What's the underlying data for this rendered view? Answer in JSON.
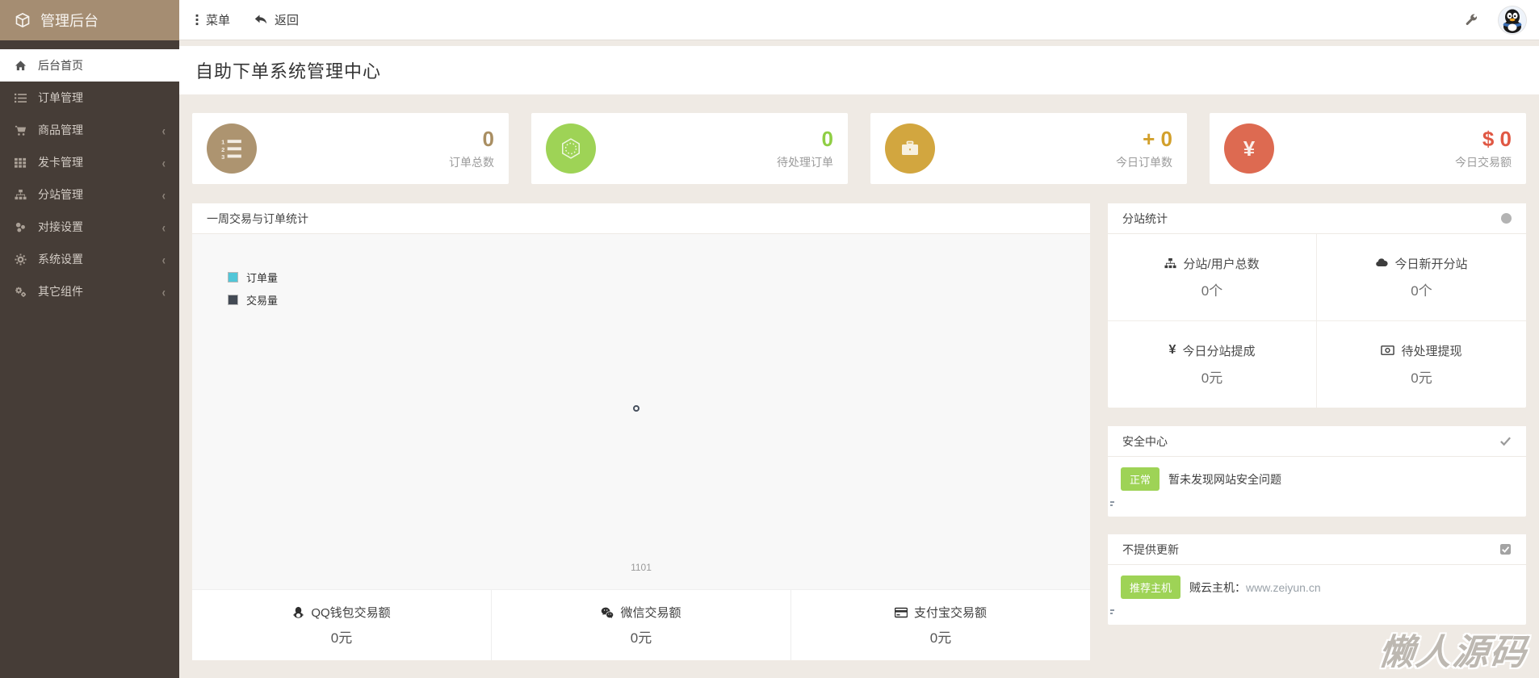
{
  "brand": {
    "title": "管理后台"
  },
  "topbar": {
    "menu": "菜单",
    "back": "返回"
  },
  "page": {
    "title": "自助下单系统管理中心"
  },
  "sidebar": {
    "items": [
      {
        "label": "后台首页",
        "icon": "home-icon",
        "active": true,
        "expandable": false
      },
      {
        "label": "订单管理",
        "icon": "list-icon",
        "active": false,
        "expandable": false
      },
      {
        "label": "商品管理",
        "icon": "cart-icon",
        "active": false,
        "expandable": true
      },
      {
        "label": "发卡管理",
        "icon": "grid-icon",
        "active": false,
        "expandable": true
      },
      {
        "label": "分站管理",
        "icon": "sitemap-icon",
        "active": false,
        "expandable": true
      },
      {
        "label": "对接设置",
        "icon": "links-icon",
        "active": false,
        "expandable": true
      },
      {
        "label": "系统设置",
        "icon": "gear-icon",
        "active": false,
        "expandable": true
      },
      {
        "label": "其它组件",
        "icon": "cogs-icon",
        "active": false,
        "expandable": true
      }
    ],
    "chevron": "‹"
  },
  "stat_cards": [
    {
      "value": "0",
      "label": "订单总数",
      "icon": "ordered-list-icon",
      "color": "#ad9470"
    },
    {
      "value": "0",
      "label": "待处理订单",
      "icon": "gem-icon",
      "color": "#9ed356"
    },
    {
      "value": "+ 0",
      "label": "今日订单数",
      "icon": "briefcase-icon",
      "color": "#d2a63f"
    },
    {
      "value": "$ 0",
      "label": "今日交易额",
      "icon": "yen-icon",
      "color": "#dd6a51"
    }
  ],
  "chart_panel": {
    "title": "一周交易与订单统计",
    "legend": [
      {
        "label": "订单量",
        "color": "#51c6d8"
      },
      {
        "label": "交易量",
        "color": "#434a54"
      }
    ],
    "x_tick": "1101"
  },
  "payments": [
    {
      "label": "QQ钱包交易额",
      "value": "0元",
      "icon": "qq-icon"
    },
    {
      "label": "微信交易额",
      "value": "0元",
      "icon": "wechat-icon"
    },
    {
      "label": "支付宝交易额",
      "value": "0元",
      "icon": "creditcard-icon"
    }
  ],
  "substation_panel": {
    "title": "分站统计",
    "stats": [
      {
        "label": "分站/用户总数",
        "value": "0个",
        "icon": "sitemap-icon"
      },
      {
        "label": "今日新开分站",
        "value": "0个",
        "icon": "cloud-icon"
      },
      {
        "label": "今日分站提成",
        "value": "0元",
        "icon": "yen-icon",
        "icon_glyph": "¥"
      },
      {
        "label": "待处理提现",
        "value": "0元",
        "icon": "money-icon"
      }
    ]
  },
  "security_panel": {
    "title": "安全中心",
    "badge": "正常",
    "message": "暂未发现网站安全问题"
  },
  "update_panel": {
    "title": "不提供更新",
    "badge": "推荐主机",
    "host_label": "贼云主机：",
    "link": "www.zeiyun.cn"
  },
  "watermark": {
    "text": "懒人源码"
  },
  "colors": {
    "brand_bg": "#a58d72",
    "sidebar_bg": "#463d37",
    "page_bg": "#efeae4",
    "card1": "#ad9470",
    "card2": "#9ed356",
    "card3": "#d2a63f",
    "card4": "#dd6a51",
    "legend_orders": "#51c6d8",
    "legend_trades": "#434a54",
    "badge_green": "#9ed356"
  }
}
